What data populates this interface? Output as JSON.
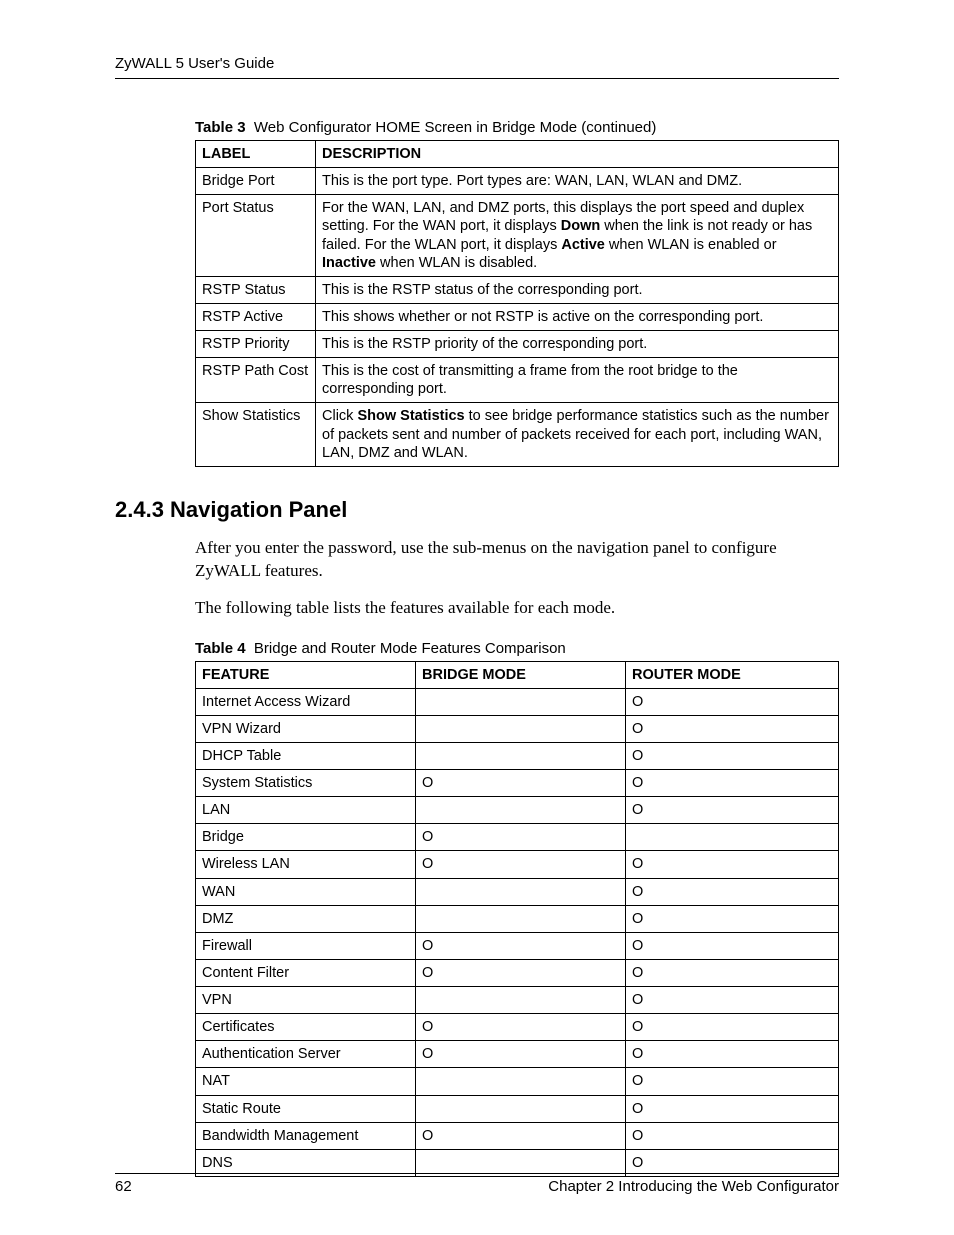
{
  "header": {
    "title": "ZyWALL 5 User's Guide"
  },
  "table3": {
    "caption_label": "Table 3",
    "caption_text": "Web Configurator HOME Screen in Bridge Mode (continued)",
    "headers": {
      "col1": "LABEL",
      "col2": "DESCRIPTION"
    },
    "rows": [
      {
        "label": "Bridge Port",
        "desc_html": "This is the port type. Port types are: WAN, LAN, WLAN and DMZ."
      },
      {
        "label": "Port Status",
        "desc_html": "For the WAN, LAN, and DMZ ports, this displays the port speed and duplex setting. For the WAN port, it displays <b>Down</b> when the link is not ready or has failed. For the WLAN port, it displays <b>Active</b> when WLAN is enabled or <b>Inactive</b> when WLAN is disabled."
      },
      {
        "label": "RSTP Status",
        "desc_html": "This is the RSTP status of the corresponding port."
      },
      {
        "label": "RSTP Active",
        "desc_html": "This shows whether or not RSTP is active on the corresponding port."
      },
      {
        "label": "RSTP Priority",
        "desc_html": "This is the RSTP priority of the corresponding port."
      },
      {
        "label": "RSTP Path Cost",
        "desc_html": "This is the cost of transmitting a frame from the root bridge to the corresponding port."
      },
      {
        "label": "Show Statistics",
        "desc_html": "Click <b>Show Statistics</b> to see bridge performance statistics such as the number of packets sent and number of packets received for each port, including WAN, LAN, DMZ and WLAN."
      }
    ]
  },
  "section": {
    "heading": "2.4.3  Navigation Panel"
  },
  "paragraphs": {
    "p1": "After you enter the password, use the sub-menus on the navigation panel to configure ZyWALL features.",
    "p2": "The following table lists the features available for each mode."
  },
  "table4": {
    "caption_label": "Table 4",
    "caption_text": "Bridge and Router Mode Features Comparison",
    "headers": {
      "col1": "FEATURE",
      "col2": "BRIDGE MODE",
      "col3": "ROUTER MODE"
    },
    "rows": [
      {
        "feature": "Internet Access Wizard",
        "bridge": "",
        "router": "O"
      },
      {
        "feature": "VPN Wizard",
        "bridge": "",
        "router": "O"
      },
      {
        "feature": "DHCP Table",
        "bridge": "",
        "router": "O"
      },
      {
        "feature": "System Statistics",
        "bridge": "O",
        "router": "O"
      },
      {
        "feature": "LAN",
        "bridge": "",
        "router": "O"
      },
      {
        "feature": "Bridge",
        "bridge": "O",
        "router": ""
      },
      {
        "feature": "Wireless LAN",
        "bridge": "O",
        "router": "O"
      },
      {
        "feature": "WAN",
        "bridge": "",
        "router": "O"
      },
      {
        "feature": "DMZ",
        "bridge": "",
        "router": "O"
      },
      {
        "feature": "Firewall",
        "bridge": "O",
        "router": "O"
      },
      {
        "feature": "Content Filter",
        "bridge": "O",
        "router": "O"
      },
      {
        "feature": "VPN",
        "bridge": "",
        "router": "O"
      },
      {
        "feature": "Certificates",
        "bridge": "O",
        "router": "O"
      },
      {
        "feature": "Authentication Server",
        "bridge": "O",
        "router": "O"
      },
      {
        "feature": "NAT",
        "bridge": "",
        "router": "O"
      },
      {
        "feature": "Static Route",
        "bridge": "",
        "router": "O"
      },
      {
        "feature": "Bandwidth Management",
        "bridge": "O",
        "router": "O"
      },
      {
        "feature": "DNS",
        "bridge": "",
        "router": "O"
      }
    ]
  },
  "footer": {
    "page_number": "62",
    "chapter": "Chapter 2 Introducing the Web Configurator"
  }
}
